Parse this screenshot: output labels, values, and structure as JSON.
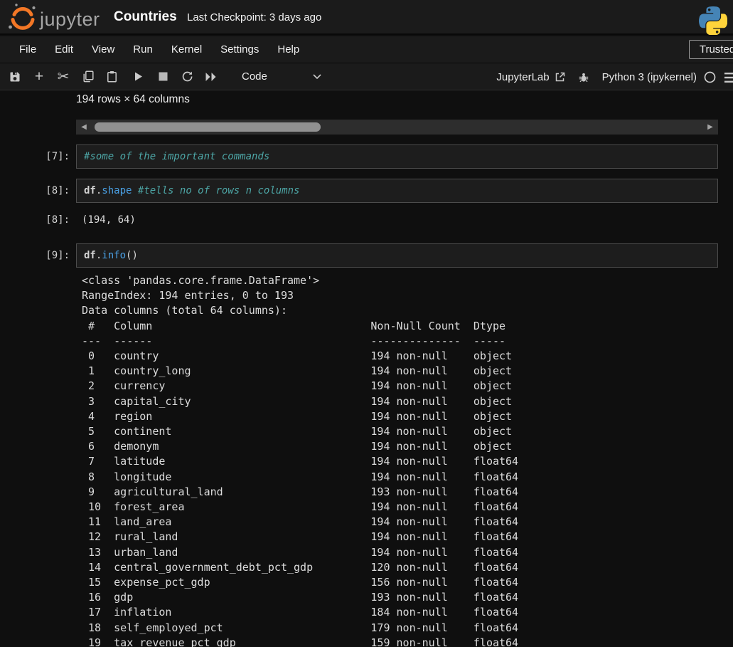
{
  "topbar": {
    "logo_text": "jupyter",
    "title": "Countries",
    "checkpoint": "Last Checkpoint: 3 days ago"
  },
  "menubar": {
    "items": [
      "File",
      "Edit",
      "View",
      "Run",
      "Kernel",
      "Settings",
      "Help"
    ],
    "trusted_label": "Trusted"
  },
  "toolbar": {
    "icons": [
      "save-icon",
      "add-cell-icon",
      "cut-icon",
      "copy-icon",
      "paste-icon",
      "run-icon",
      "stop-icon",
      "restart-kernel-icon",
      "run-all-icon",
      "chevron-down-icon",
      "external-link-icon",
      "debugger-bug-icon",
      "kernel-status-circle-icon",
      "hamburger-menu-icon"
    ],
    "cell_type": "Code",
    "jupyterlab_link": "JupyterLab",
    "kernel_name": "Python 3 (ipykernel)"
  },
  "dataframe_summary": "194 rows × 64 columns",
  "cells": [
    {
      "prompt": "[7]:",
      "tokens": [
        [
          "#some of the important commands",
          "comment"
        ]
      ]
    },
    {
      "prompt": "[8]:",
      "tokens": [
        [
          "df",
          "name"
        ],
        [
          ".",
          "plain"
        ],
        [
          "shape",
          "prop"
        ],
        [
          " ",
          "plain"
        ],
        [
          "#tells no of rows n columns",
          "comment"
        ]
      ]
    },
    {
      "prompt": "[9]:",
      "tokens": [
        [
          "df",
          "name"
        ],
        [
          ".",
          "plain"
        ],
        [
          "info",
          "prop"
        ],
        [
          "()",
          "plain"
        ]
      ]
    }
  ],
  "outputs": [
    {
      "prompt": "[8]:",
      "text": "(194, 64)"
    }
  ],
  "info_output": {
    "header_lines": [
      "<class 'pandas.core.frame.DataFrame'>",
      "RangeIndex: 194 entries, 0 to 193",
      "Data columns (total 64 columns):"
    ],
    "table_header": [
      "#",
      "Column",
      "Non-Null Count",
      "Dtype"
    ],
    "separators": [
      "---",
      "------",
      "--------------",
      "-----"
    ],
    "rows": [
      [
        "0",
        "country",
        "194 non-null",
        "object"
      ],
      [
        "1",
        "country_long",
        "194 non-null",
        "object"
      ],
      [
        "2",
        "currency",
        "194 non-null",
        "object"
      ],
      [
        "3",
        "capital_city",
        "194 non-null",
        "object"
      ],
      [
        "4",
        "region",
        "194 non-null",
        "object"
      ],
      [
        "5",
        "continent",
        "194 non-null",
        "object"
      ],
      [
        "6",
        "demonym",
        "194 non-null",
        "object"
      ],
      [
        "7",
        "latitude",
        "194 non-null",
        "float64"
      ],
      [
        "8",
        "longitude",
        "194 non-null",
        "float64"
      ],
      [
        "9",
        "agricultural_land",
        "193 non-null",
        "float64"
      ],
      [
        "10",
        "forest_area",
        "194 non-null",
        "float64"
      ],
      [
        "11",
        "land_area",
        "194 non-null",
        "float64"
      ],
      [
        "12",
        "rural_land",
        "194 non-null",
        "float64"
      ],
      [
        "13",
        "urban_land",
        "194 non-null",
        "float64"
      ],
      [
        "14",
        "central_government_debt_pct_gdp",
        "120 non-null",
        "float64"
      ],
      [
        "15",
        "expense_pct_gdp",
        "156 non-null",
        "float64"
      ],
      [
        "16",
        "gdp",
        "193 non-null",
        "float64"
      ],
      [
        "17",
        "inflation",
        "184 non-null",
        "float64"
      ],
      [
        "18",
        "self_employed_pct",
        "179 non-null",
        "float64"
      ],
      [
        "19",
        "tax_revenue_pct_gdp",
        "159 non-null",
        "float64"
      ]
    ]
  },
  "colors": {
    "jupyter_orange": "#f37726",
    "python_blue": "#4584b6",
    "python_yellow": "#ffd43b",
    "code_property_blue": "#4aa0e4",
    "code_comment_teal": "#4da6a6",
    "bar_background": "#1b1b1b",
    "page_background": "#0f0f0f"
  }
}
